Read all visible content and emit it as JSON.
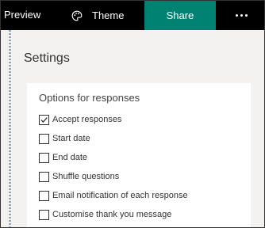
{
  "topbar": {
    "preview": "Preview",
    "theme": "Theme",
    "share": "Share",
    "more_icon": "more-horizontal-icon",
    "theme_icon": "palette-icon"
  },
  "settings": {
    "title": "Settings",
    "section_title": "Options for responses",
    "options": [
      {
        "label": "Accept responses",
        "checked": true
      },
      {
        "label": "Start date",
        "checked": false
      },
      {
        "label": "End date",
        "checked": false
      },
      {
        "label": "Shuffle questions",
        "checked": false
      },
      {
        "label": "Email notification of each response",
        "checked": false
      },
      {
        "label": "Customise thank you message",
        "checked": false
      }
    ]
  },
  "colors": {
    "topbar_bg": "#000000",
    "share_bg": "#008272",
    "panel_bg": "#f3f2f1",
    "card_bg": "#ffffff"
  }
}
